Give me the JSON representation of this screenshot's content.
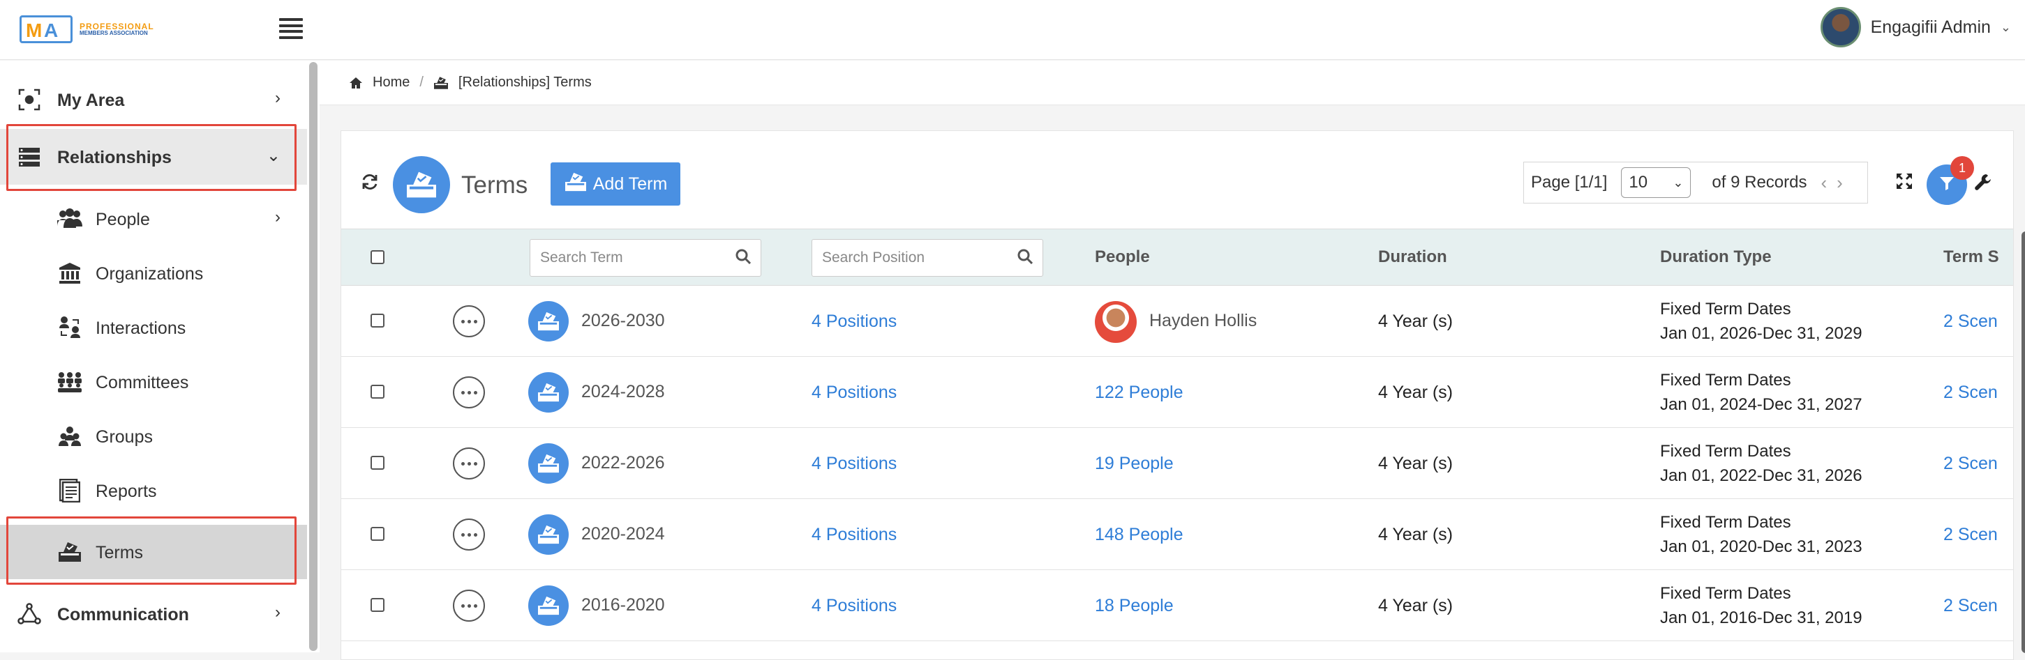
{
  "header": {
    "logo_text_1": "PROFESSIONAL",
    "logo_text_2": "MEMBERS ASSOCIATION",
    "user_name": "Engagifii Admin"
  },
  "sidebar": {
    "items": [
      {
        "label": "My Area",
        "icon": "target-icon"
      },
      {
        "label": "Relationships",
        "icon": "server-stack-icon",
        "expanded": true
      },
      {
        "label": "People",
        "icon": "users-icon"
      },
      {
        "label": "Organizations",
        "icon": "bank-icon"
      },
      {
        "label": "Interactions",
        "icon": "interaction-icon"
      },
      {
        "label": "Committees",
        "icon": "committee-icon"
      },
      {
        "label": "Groups",
        "icon": "group-icon"
      },
      {
        "label": "Reports",
        "icon": "report-icon"
      },
      {
        "label": "Terms",
        "icon": "ballot-icon",
        "active": true
      },
      {
        "label": "Communication",
        "icon": "network-icon"
      }
    ]
  },
  "breadcrumb": {
    "home": "Home",
    "current": "[Relationships] Terms"
  },
  "toolbar": {
    "title": "Terms",
    "add_label": "Add Term",
    "page_label": "Page [1/1]",
    "page_size": "10",
    "records_label": "of 9 Records",
    "filter_count": "1"
  },
  "table": {
    "search_term_placeholder": "Search Term",
    "search_position_placeholder": "Search Position",
    "columns": {
      "people": "People",
      "duration": "Duration",
      "duration_type": "Duration Type",
      "term_s": "Term S"
    },
    "rows": [
      {
        "name": "2026-2030",
        "positions": "4 Positions",
        "people": "Hayden Hollis",
        "people_is_person": true,
        "duration": "4 Year (s)",
        "dtype": "Fixed Term Dates",
        "dates": "Jan 01, 2026-Dec 31, 2029",
        "scen": "2 Scen"
      },
      {
        "name": "2024-2028",
        "positions": "4 Positions",
        "people": "122 People",
        "people_is_person": false,
        "duration": "4 Year (s)",
        "dtype": "Fixed Term Dates",
        "dates": "Jan 01, 2024-Dec 31, 2027",
        "scen": "2 Scen"
      },
      {
        "name": "2022-2026",
        "positions": "4 Positions",
        "people": "19 People",
        "people_is_person": false,
        "duration": "4 Year (s)",
        "dtype": "Fixed Term Dates",
        "dates": "Jan 01, 2022-Dec 31, 2026",
        "scen": "2 Scen"
      },
      {
        "name": "2020-2024",
        "positions": "4 Positions",
        "people": "148 People",
        "people_is_person": false,
        "duration": "4 Year (s)",
        "dtype": "Fixed Term Dates",
        "dates": "Jan 01, 2020-Dec 31, 2023",
        "scen": "2 Scen"
      },
      {
        "name": "2016-2020",
        "positions": "4 Positions",
        "people": "18 People",
        "people_is_person": false,
        "duration": "4 Year (s)",
        "dtype": "Fixed Term Dates",
        "dates": "Jan 01, 2016-Dec 31, 2019",
        "scen": "2 Scen"
      }
    ]
  },
  "colors": {
    "accent": "#4a90e2",
    "link": "#2e7dd7",
    "highlight": "#e2463b",
    "header_row": "#e6f0f0"
  }
}
